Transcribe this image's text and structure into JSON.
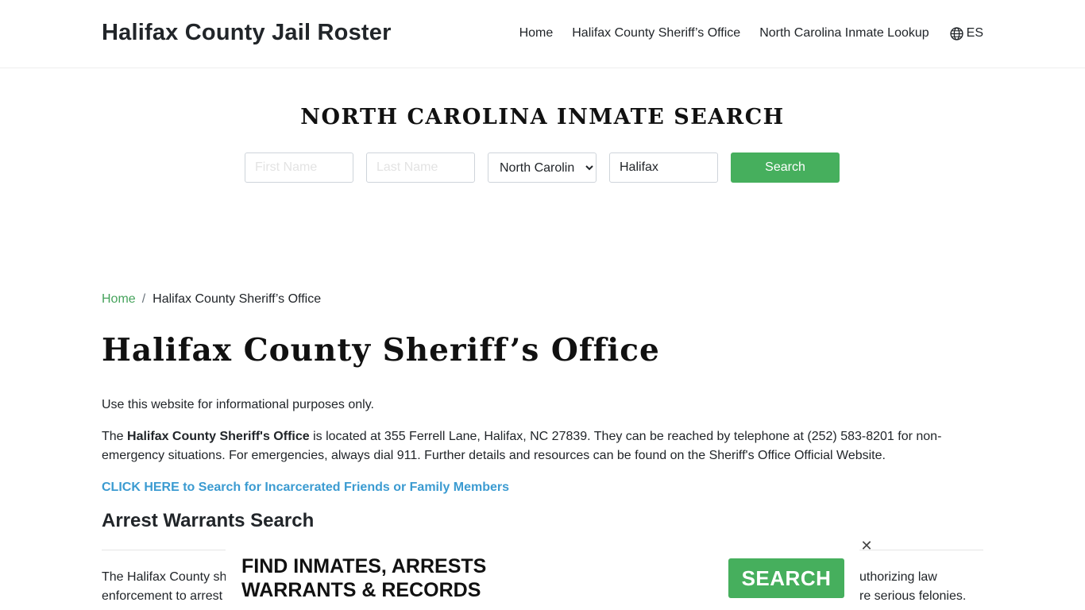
{
  "header": {
    "site_title": "Halifax County Jail Roster",
    "nav": {
      "home": "Home",
      "sheriff": "Halifax County Sheriff’s Office",
      "lookup": "North Carolina Inmate Lookup",
      "lang": "ES",
      "lang_icon": "globe-icon"
    }
  },
  "search": {
    "heading": "NORTH CAROLINA INMATE SEARCH",
    "first_name_placeholder": "First Name",
    "last_name_placeholder": "Last Name",
    "state_selected": "North Carolina",
    "county_value": "Halifax",
    "button_label": "Search"
  },
  "breadcrumb": {
    "home": "Home",
    "separator": "/",
    "current": "Halifax County Sheriff’s Office"
  },
  "page": {
    "title": "Halifax County Sheriff’s Office",
    "disclaimer": "Use this website for informational purposes only.",
    "para_prefix": "The ",
    "para_bold": "Halifax County Sheriff's Office",
    "para_rest": " is located at 355 Ferrell Lane, Halifax, NC 27839. They can be reached by telephone at (252) 583-8201 for non-emergency situations. For emergencies, always dial 911. Further details and resources can be found on the Sheriff's Office Official Website.",
    "cta_link": "CLICK HERE to Search for Incarcerated Friends or Family Members",
    "warrants_heading": "Arrest Warrants Search",
    "warrants_left": "The Halifax County sh",
    "warrants_left2": "enforcement to arrest",
    "warrants_right": "uthorizing law",
    "warrants_right2": "re serious felonies."
  },
  "ad": {
    "line1": "FIND INMATES, ARRESTS",
    "line2": "WARRANTS & RECORDS",
    "button": "SEARCH",
    "close": "✕"
  },
  "colors": {
    "accent_green": "#46af5d",
    "link_blue": "#3b9bd1"
  }
}
